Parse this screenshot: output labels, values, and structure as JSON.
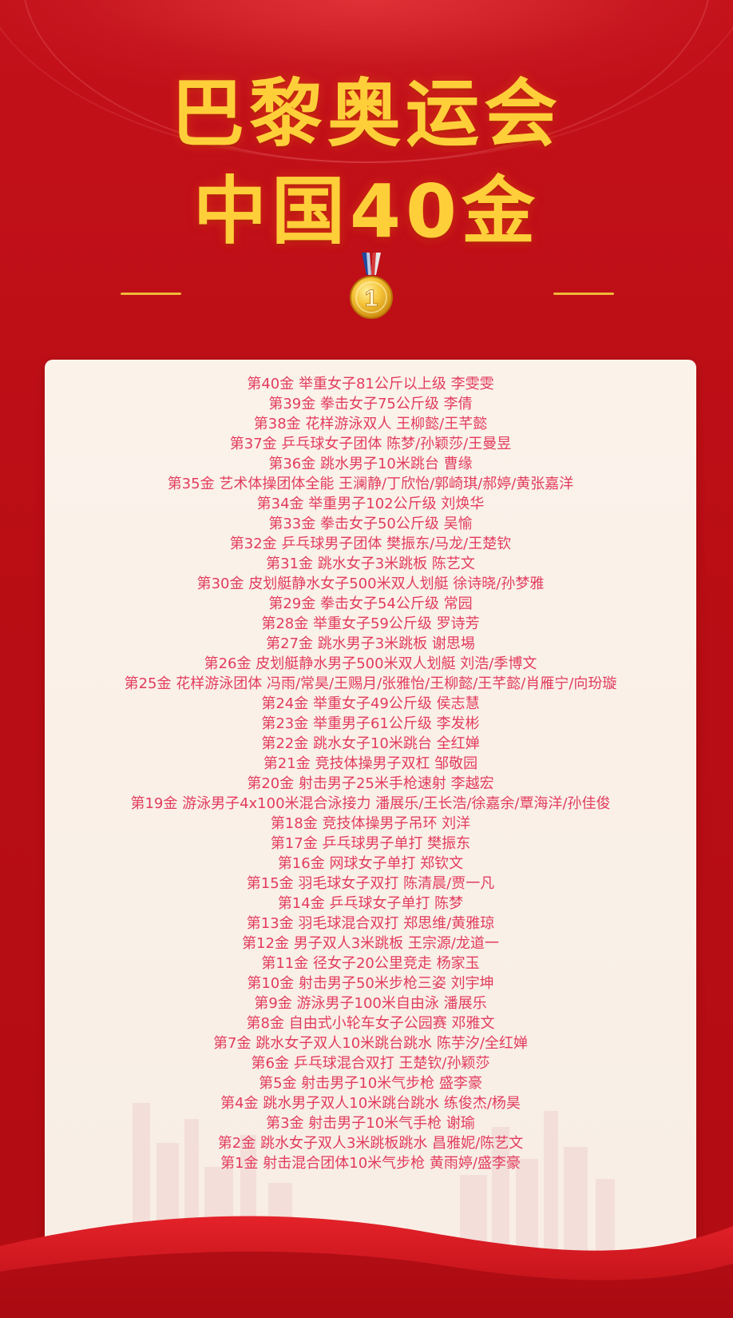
{
  "header": {
    "title_line1": "巴黎奥运会",
    "title_line2": "中国40金",
    "medal_number": "1"
  },
  "medals": [
    "第40金 举重女子81公斤以上级 李雯雯",
    "第39金 拳击女子75公斤级 李倩",
    "第38金 花样游泳双人 王柳懿/王芊懿",
    "第37金 乒乓球女子团体 陈梦/孙颖莎/王曼昱",
    "第36金 跳水男子10米跳台 曹缘",
    "第35金 艺术体操团体全能 王澜静/丁欣怡/郭崎琪/郝婷/黄张嘉洋",
    "第34金 举重男子102公斤级 刘焕华",
    "第33金 拳击女子50公斤级 吴愉",
    "第32金 乒乓球男子团体 樊振东/马龙/王楚钦",
    "第31金 跳水女子3米跳板 陈艺文",
    "第30金 皮划艇静水女子500米双人划艇 徐诗晓/孙梦雅",
    "第29金 拳击女子54公斤级 常园",
    "第28金 举重女子59公斤级 罗诗芳",
    "第27金 跳水男子3米跳板 谢思埸",
    "第26金 皮划艇静水男子500米双人划艇 刘浩/季博文",
    "第25金 花样游泳团体 冯雨/常昊/王赐月/张雅怡/王柳懿/王芊懿/肖雁宁/向玢璇",
    "第24金 举重女子49公斤级 侯志慧",
    "第23金 举重男子61公斤级 李发彬",
    "第22金 跳水女子10米跳台 全红婵",
    "第21金 竞技体操男子双杠 邹敬园",
    "第20金 射击男子25米手枪速射 李越宏",
    "第19金 游泳男子4x100米混合泳接力 潘展乐/王长浩/徐嘉余/覃海洋/孙佳俊",
    "第18金 竞技体操男子吊环 刘洋",
    "第17金 乒乓球男子单打 樊振东",
    "第16金 网球女子单打 郑钦文",
    "第15金 羽毛球女子双打 陈清晨/贾一凡",
    "第14金 乒乓球女子单打 陈梦",
    "第13金 羽毛球混合双打 郑思维/黄雅琼",
    "第12金 男子双人3米跳板 王宗源/龙道一",
    "第11金 径女子20公里竞走 杨家玉",
    "第10金 射击男子50米步枪三姿 刘宇坤",
    "第9金 游泳男子100米自由泳 潘展乐",
    "第8金 自由式小轮车女子公园赛 邓雅文",
    "第7金 跳水女子双人10米跳台跳水 陈芋汐/全红婵",
    "第6金 乒乓球混合双打 王楚钦/孙颖莎",
    "第5金 射击男子10米气步枪 盛李豪",
    "第4金 跳水男子双人10米跳台跳水 练俊杰/杨昊",
    "第3金 射击男子10米气手枪 谢瑜",
    "第2金 跳水女子双人3米跳板跳水 昌雅妮/陈艺文",
    "第1金 射击混合团体10米气步枪 黄雨婷/盛李豪"
  ]
}
